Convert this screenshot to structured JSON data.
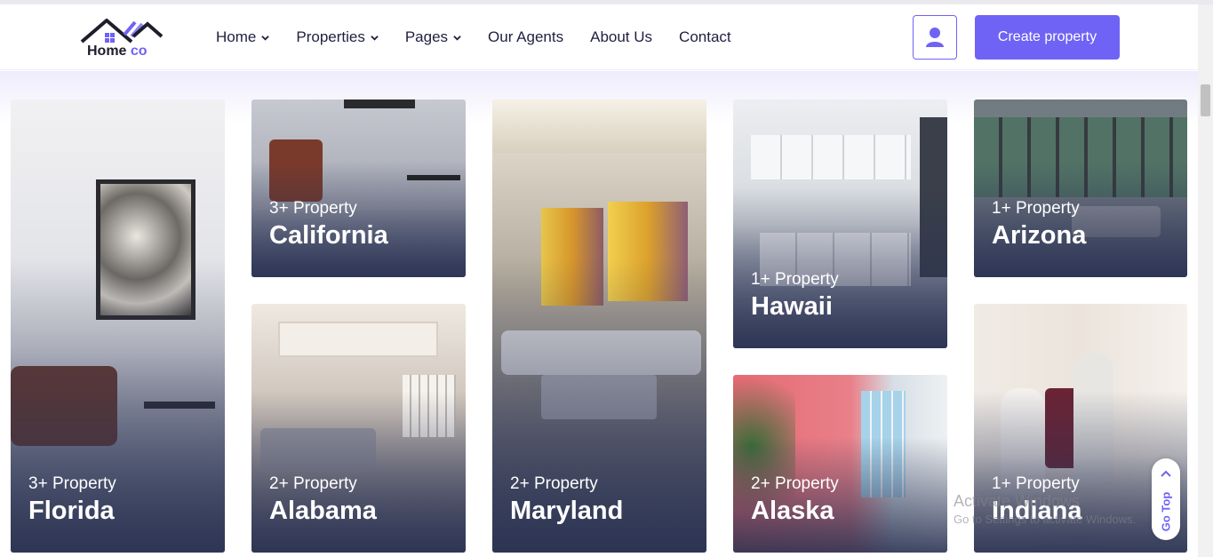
{
  "brand": {
    "name_a": "Home",
    "name_b": "co",
    "accent": "#6f63f5"
  },
  "nav": {
    "items": [
      {
        "label": "Home",
        "dropdown": true
      },
      {
        "label": "Properties",
        "dropdown": true
      },
      {
        "label": "Pages",
        "dropdown": true
      },
      {
        "label": "Our Agents",
        "dropdown": false
      },
      {
        "label": "About Us",
        "dropdown": false
      },
      {
        "label": "Contact",
        "dropdown": false
      }
    ],
    "user_icon": "user-icon",
    "create_label": "Create property"
  },
  "cards": [
    {
      "count": "3+ Property",
      "state": "Florida"
    },
    {
      "count": "3+ Property",
      "state": "California"
    },
    {
      "count": "2+ Property",
      "state": "Alabama"
    },
    {
      "count": "2+ Property",
      "state": "Maryland"
    },
    {
      "count": "1+ Property",
      "state": "Hawaii"
    },
    {
      "count": "2+ Property",
      "state": "Alaska"
    },
    {
      "count": "1+ Property",
      "state": "Arizona"
    },
    {
      "count": "1+ Property",
      "state": "Indiana"
    }
  ],
  "watermark": {
    "title": "Activate Windows",
    "subtitle": "Go to Settings to activate Windows."
  },
  "go_top": {
    "label": "Go Top"
  }
}
